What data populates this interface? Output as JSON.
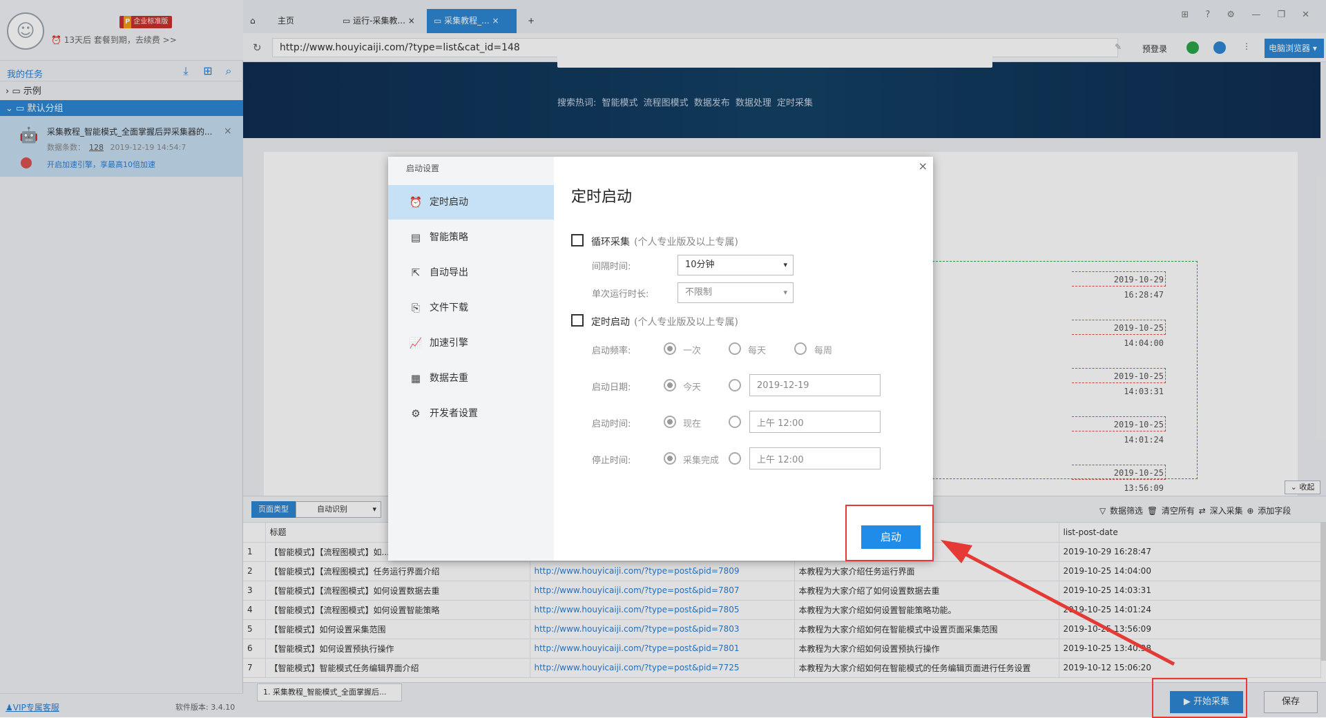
{
  "app": {
    "badge": "企业标准版",
    "badge_p": "P",
    "expire_text": "13天后 套餐到期，去续费 >>",
    "my_tasks": "我的任务",
    "tree_example": "示例",
    "tree_default": "默认分组",
    "task": {
      "name": "采集教程_智能模式_全面掌握后羿采集器的...",
      "count_label": "数据条数：",
      "count": "128",
      "time": "2019-12-19 14:54:7",
      "speedup": "开启加速引擎，享最高10倍加速"
    },
    "vip_link": "VIP专属客服",
    "version": "软件版本: 3.4.10"
  },
  "tabs": [
    {
      "label": "主页"
    },
    {
      "label": "运行-采集教..."
    },
    {
      "label": "采集教程_..."
    }
  ],
  "address": {
    "url": "http://www.houyicaiji.com/?type=list&cat_id=148",
    "prelogin": "预登录",
    "pc_browser": "电脑浏览器"
  },
  "web": {
    "search_hot": "搜索热词:  智能模式  流程图模式  数据发布  数据处理  定时采集",
    "dates": [
      "2019-10-29 16:28:47",
      "2019-10-25 14:04:00",
      "2019-10-25 14:03:31",
      "2019-10-25 14:01:24",
      "2019-10-25 13:56:09"
    ],
    "collapse": "收起"
  },
  "datapane": {
    "pagetype": "页面类型",
    "autodetect": "自动识别",
    "actions": "▽ 数据筛选   🗑 清空所有   ⇄ 深入采集   ⊕ 添加字段",
    "columns": [
      "",
      "标题",
      "",
      "",
      "list-post-date"
    ],
    "rows": [
      {
        "n": "1",
        "title": "【智能模式】【流程图模式】如...",
        "url": "",
        "desc": "",
        "date": "2019-10-29 16:28:47"
      },
      {
        "n": "2",
        "title": "【智能模式】【流程图模式】任务运行界面介绍",
        "url": "http://www.houyicaiji.com/?type=post&pid=7809",
        "desc": "本教程为大家介绍任务运行界面",
        "date": "2019-10-25 14:04:00"
      },
      {
        "n": "3",
        "title": "【智能模式】【流程图模式】如何设置数据去重",
        "url": "http://www.houyicaiji.com/?type=post&pid=7807",
        "desc": "本教程为大家介绍了如何设置数据去重",
        "date": "2019-10-25 14:03:31"
      },
      {
        "n": "4",
        "title": "【智能模式】【流程图模式】如何设置智能策略",
        "url": "http://www.houyicaiji.com/?type=post&pid=7805",
        "desc": "本教程为大家介绍如何设置智能策略功能。",
        "date": "2019-10-25 14:01:24"
      },
      {
        "n": "5",
        "title": "【智能模式】如何设置采集范围",
        "url": "http://www.houyicaiji.com/?type=post&pid=7803",
        "desc": "本教程为大家介绍如何在智能模式中设置页面采集范围",
        "date": "2019-10-25 13:56:09"
      },
      {
        "n": "6",
        "title": "【智能模式】如何设置预执行操作",
        "url": "http://www.houyicaiji.com/?type=post&pid=7801",
        "desc": "本教程为大家介绍如何设置预执行操作",
        "date": "2019-10-25 13:40:38"
      },
      {
        "n": "7",
        "title": "【智能模式】智能模式任务编辑界面介绍",
        "url": "http://www.houyicaiji.com/?type=post&pid=7725",
        "desc": "本教程为大家介绍如何在智能模式的任务编辑页面进行任务设置",
        "date": "2019-10-12 15:06:20"
      }
    ],
    "task_chip": "1. 采集教程_智能模式_全面掌握后...",
    "start": "▶ 开始采集",
    "save": "保存"
  },
  "modal": {
    "title": "启动设置",
    "nav": [
      {
        "label": "定时启动",
        "icon": "alarm-clock-icon"
      },
      {
        "label": "智能策略",
        "icon": "strategy-icon"
      },
      {
        "label": "自动导出",
        "icon": "export-icon"
      },
      {
        "label": "文件下载",
        "icon": "file-download-icon"
      },
      {
        "label": "加速引擎",
        "icon": "speed-chart-icon"
      },
      {
        "label": "数据去重",
        "icon": "dedupe-icon"
      },
      {
        "label": "开发者设置",
        "icon": "gear-icon"
      }
    ],
    "panel_title": "定时启动",
    "loop_label": "循环采集",
    "loop_note": "(个人专业版及以上专属)",
    "interval_label": "间隔时间:",
    "interval_value": "10分钟",
    "run_duration_label": "单次运行时长:",
    "run_duration_value": "不限制",
    "timer_label": "定时启动",
    "timer_note": "(个人专业版及以上专属)",
    "freq_label": "启动频率:",
    "freq_options": [
      "一次",
      "每天",
      "每周"
    ],
    "date_label": "启动日期:",
    "date_today": "今天",
    "date_value": "2019-12-19",
    "time_label": "启动时间:",
    "time_now": "现在",
    "time_value": "上午 12:00",
    "stop_label": "停止时间:",
    "stop_done": "采集完成",
    "stop_value": "上午 12:00",
    "launch": "启动"
  }
}
